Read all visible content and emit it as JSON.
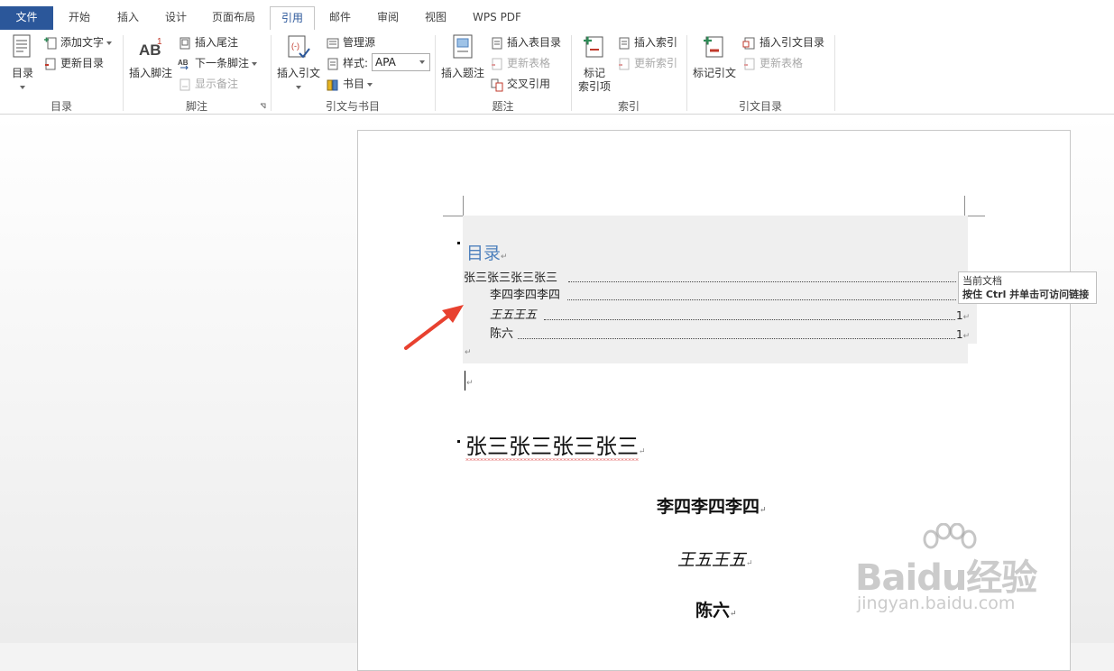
{
  "tabs": [
    {
      "label": "文件",
      "active": false
    },
    {
      "label": "开始",
      "active": false
    },
    {
      "label": "插入",
      "active": false
    },
    {
      "label": "设计",
      "active": false
    },
    {
      "label": "页面布局",
      "active": false
    },
    {
      "label": "引用",
      "active": true
    },
    {
      "label": "邮件",
      "active": false
    },
    {
      "label": "审阅",
      "active": false
    },
    {
      "label": "视图",
      "active": false
    },
    {
      "label": "WPS PDF",
      "active": false
    }
  ],
  "ribbon": {
    "toc_group": {
      "label": "目录",
      "toc_button": "目录",
      "add_text": "添加文字",
      "update_toc": "更新目录"
    },
    "footnote_group": {
      "label": "脚注",
      "insert_footnote": "插入脚注",
      "insert_endnote": "插入尾注",
      "next_footnote": "下一条脚注",
      "show_notes": "显示备注"
    },
    "citation_group": {
      "label": "引文与书目",
      "insert_citation": "插入引文",
      "manage_sources": "管理源",
      "style_label": "样式:",
      "style_value": "APA",
      "bibliography": "书目"
    },
    "caption_group": {
      "label": "题注",
      "insert_caption": "插入题注",
      "insert_table_of_figures": "插入表目录",
      "update_table": "更新表格",
      "cross_reference": "交叉引用"
    },
    "index_group": {
      "label": "索引",
      "mark_entry_line1": "标记",
      "mark_entry_line2": "索引项",
      "insert_index": "插入索引",
      "update_index": "更新索引"
    },
    "authorities_group": {
      "label": "引文目录",
      "mark_citation": "标记引文",
      "insert_authorities": "插入引文目录",
      "update_table": "更新表格"
    }
  },
  "document": {
    "toc_title": "目录",
    "toc_entries": [
      {
        "text": "张三张三张三张三",
        "page": "",
        "italic": false
      },
      {
        "text": "李四李四李四",
        "page": "",
        "italic": false
      },
      {
        "text": "王五王五",
        "page": "1",
        "italic": true
      },
      {
        "text": "陈六",
        "page": "1",
        "italic": false
      }
    ],
    "tooltip_line1": "当前文档",
    "tooltip_line2": "按住 Ctrl 并单击可访问链接",
    "heading1": "张三张三张三张三",
    "heading2": "李四李四李四",
    "heading3": "王五王五",
    "heading4": "陈六",
    "paragraph_mark": "↵"
  },
  "watermark": {
    "brand": "Baidu经验",
    "url": "jingyan.baidu.com"
  },
  "colors": {
    "file_tab": "#2b579a",
    "toc_title": "#4f81bd",
    "arrow": "#e8412f"
  }
}
